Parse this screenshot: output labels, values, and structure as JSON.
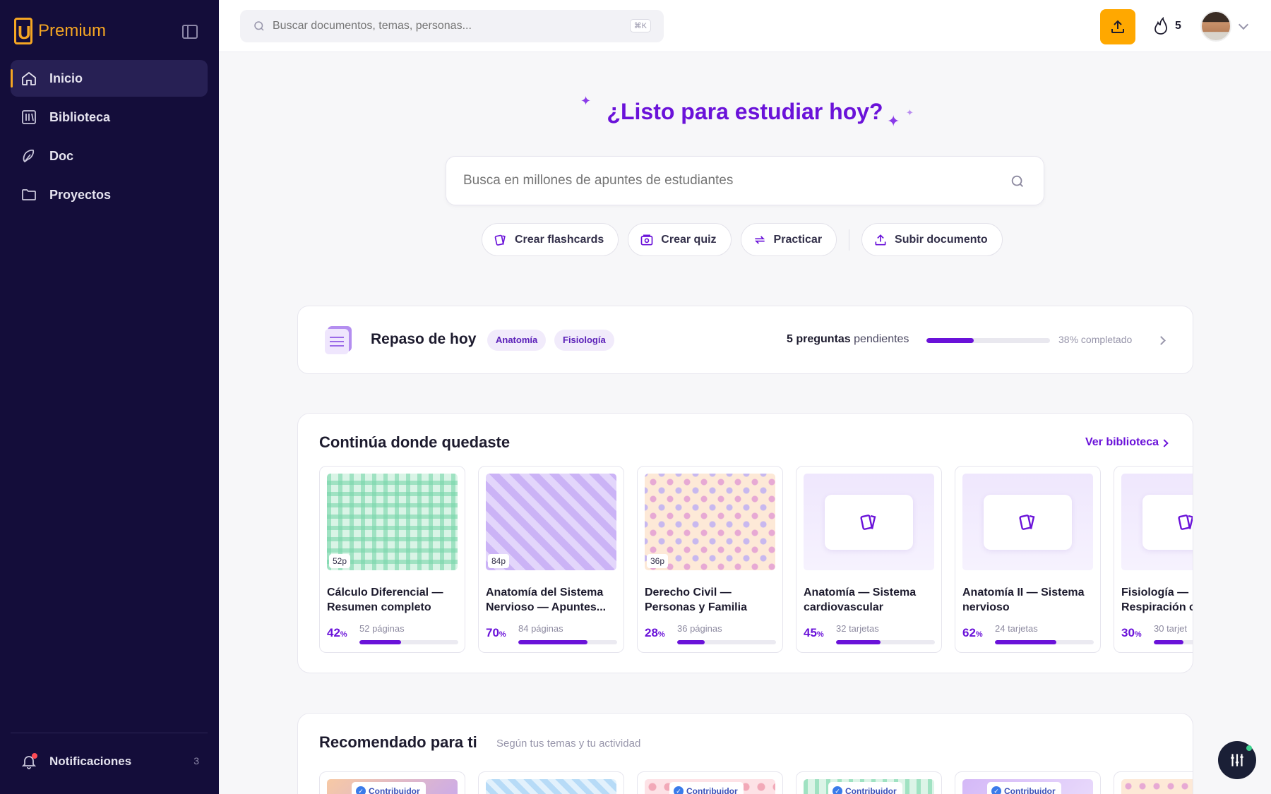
{
  "brand": {
    "name": "Premium",
    "color": "#f5a623"
  },
  "sidebar": {
    "items": [
      {
        "label": "Inicio",
        "icon": "home-icon",
        "active": true
      },
      {
        "label": "Biblioteca",
        "icon": "library-icon"
      },
      {
        "label": "Doc",
        "icon": "doc-icon"
      },
      {
        "label": "Proyectos",
        "icon": "folder-icon"
      }
    ],
    "notifications": {
      "label": "Notificaciones",
      "count": "3"
    }
  },
  "topbar": {
    "search_placeholder": "Buscar documentos, temas, personas...",
    "shortcut": "⌘K",
    "streak": "5"
  },
  "hero": {
    "title": "¿Listo para estudiar hoy?",
    "search_placeholder": "Busca en millones de apuntes de estudiantes",
    "actions": [
      {
        "label": "Crear flashcards",
        "icon": "flashcards-icon"
      },
      {
        "label": "Crear quiz",
        "icon": "quiz-icon"
      },
      {
        "label": "Practicar",
        "icon": "practice-icon"
      },
      {
        "label": "Subir documento",
        "icon": "upload-icon"
      }
    ]
  },
  "review": {
    "title": "Repaso de hoy",
    "tags": [
      "Anatomía",
      "Fisiología"
    ],
    "pending_count": "5 preguntas",
    "pending_suffix": "pendientes",
    "progress": 0.38,
    "progress_label": "38% completado"
  },
  "continue": {
    "title": "Continúa donde quedaste",
    "link": "Ver biblioteca",
    "cards": [
      {
        "title": "Cálculo Diferencial — Resumen completo",
        "pct": "42",
        "sub": "52 páginas",
        "badge": "52p",
        "thumb": "grid",
        "progress": 0.42
      },
      {
        "title": "Anatomía del Sistema Nervioso — Apuntes...",
        "pct": "70",
        "sub": "84 páginas",
        "badge": "84p",
        "thumb": "stripes",
        "progress": 0.7
      },
      {
        "title": "Derecho Civil — Personas y Familia",
        "pct": "28",
        "sub": "36 páginas",
        "badge": "36p",
        "thumb": "dots",
        "progress": 0.28
      },
      {
        "title": "Anatomía — Sistema cardiovascular",
        "pct": "45",
        "sub": "32 tarjetas",
        "thumb": "deck",
        "progress": 0.45
      },
      {
        "title": "Anatomía II — Sistema nervioso",
        "pct": "62",
        "sub": "24 tarjetas",
        "thumb": "deck",
        "progress": 0.62
      },
      {
        "title": "Fisiología — Respiración c",
        "pct": "30",
        "sub": "30 tarjet",
        "thumb": "deck",
        "progress": 0.3
      }
    ]
  },
  "recommended": {
    "title": "Recomendado para ti",
    "subtitle": "Según tus temas y tu actividad",
    "badge_label": "Contribuidor",
    "cards": [
      {
        "thumb": "a",
        "contributor": true
      },
      {
        "thumb": "b",
        "contributor": false
      },
      {
        "thumb": "c",
        "contributor": true
      },
      {
        "thumb": "d",
        "contributor": true
      },
      {
        "thumb": "e",
        "contributor": true
      },
      {
        "thumb": "f",
        "contributor": false
      }
    ]
  },
  "accent_color": "#6a12d9"
}
